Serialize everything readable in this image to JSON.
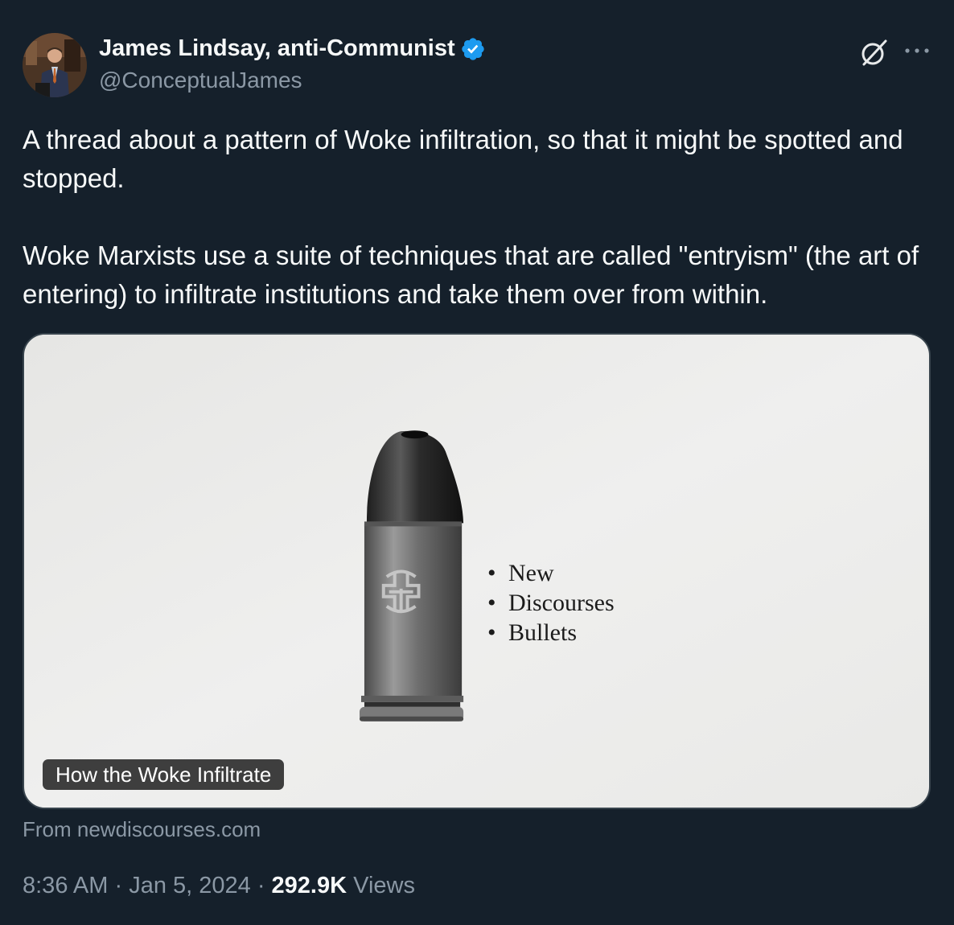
{
  "author": {
    "name": "James Lindsay, anti-Communist",
    "handle": "@ConceptualJames",
    "verified": true,
    "verified_color": "#1d9bf0"
  },
  "tweet": {
    "paragraphs": [
      "A thread about a pattern of Woke infiltration, so that it might be spotted and stopped.",
      "Woke Marxists use a suite of techniques that are called \"entryism\" (the art of entering) to infiltrate institutions and take them over from within."
    ]
  },
  "card": {
    "bullets": [
      "New",
      "Discourses",
      "Bullets"
    ],
    "title": "How the Woke Infiltrate",
    "source": "From newdiscourses.com"
  },
  "meta": {
    "time": "8:36 AM",
    "separator": " · ",
    "date": "Jan 5, 2024",
    "views_count": "292.9K",
    "views_label": " Views"
  },
  "icons": {
    "grok": "grok-icon",
    "more": "more-icon"
  },
  "colors": {
    "background": "#15202b",
    "text": "#f7f9f9",
    "secondary": "#8b98a5",
    "border": "#38444d"
  }
}
